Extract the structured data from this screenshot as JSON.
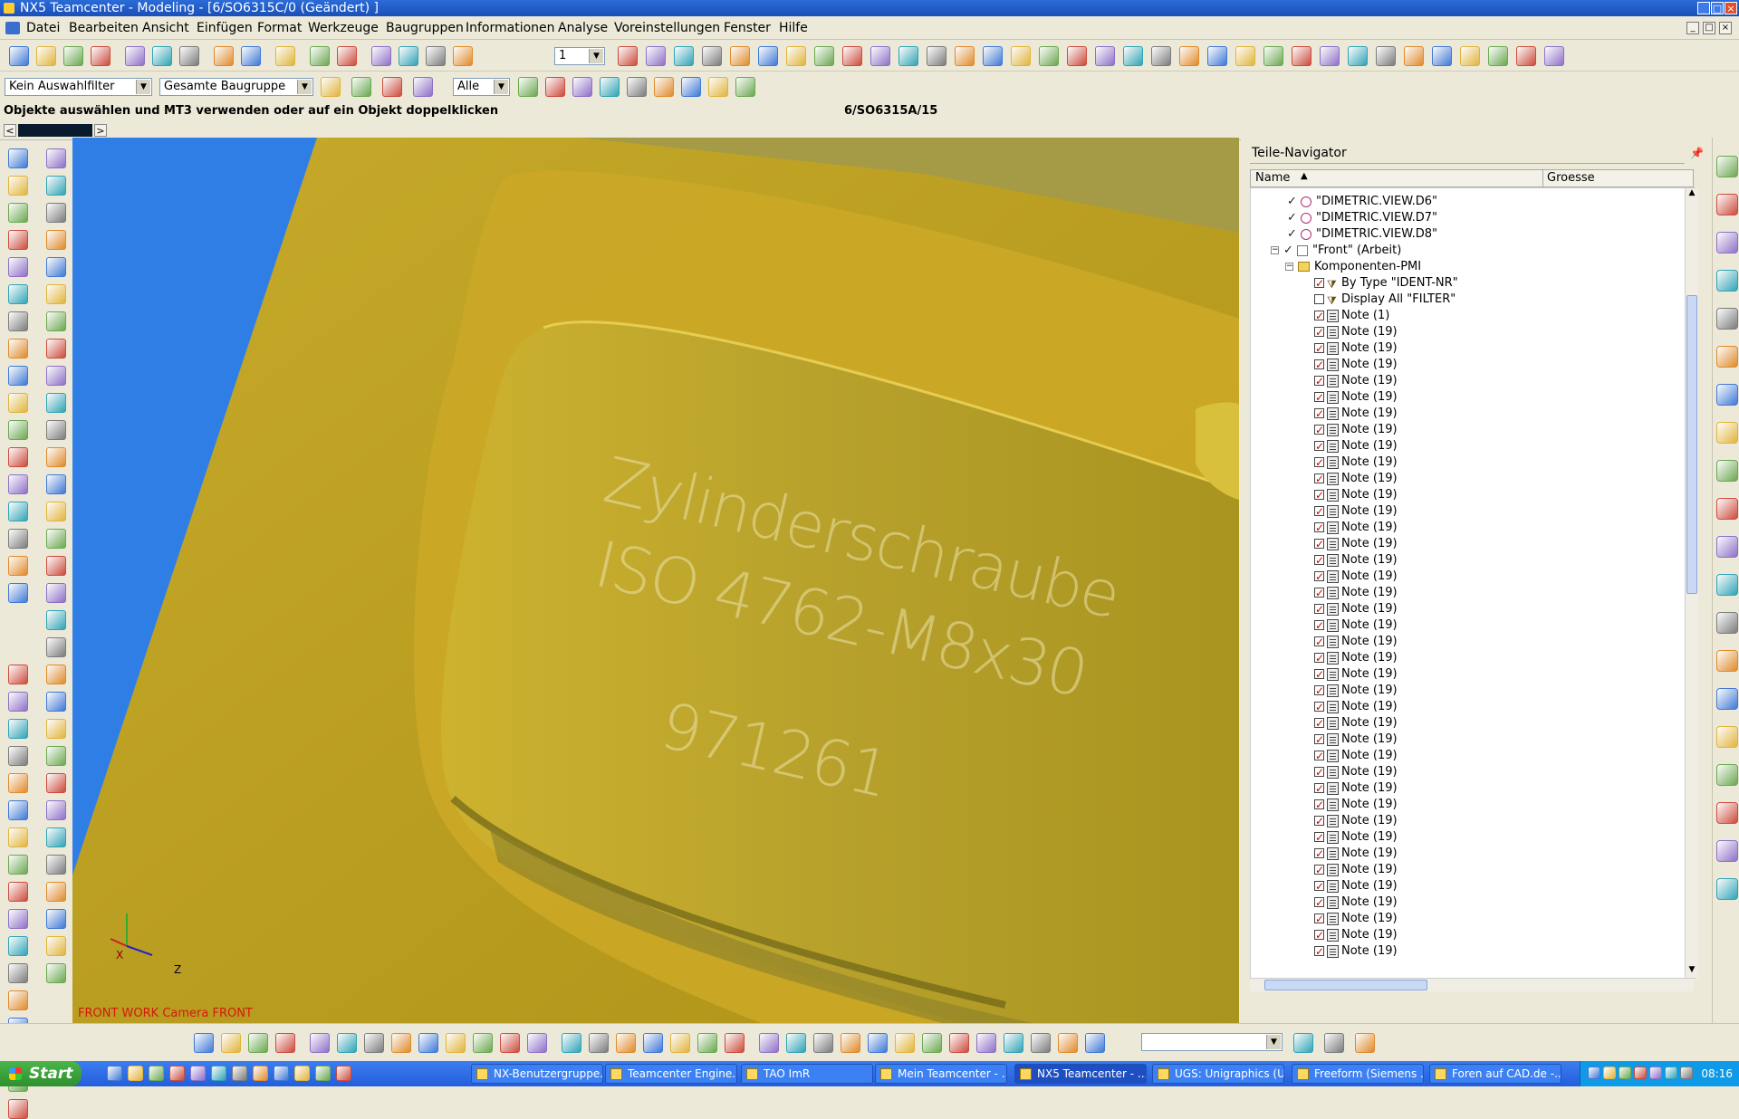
{
  "window": {
    "title": "NX5 Teamcenter - Modeling - [6/SO6315C/0 (Geändert) ]",
    "controls": [
      "_",
      "□",
      "×"
    ]
  },
  "menu": [
    "Datei",
    "Bearbeiten",
    "Ansicht",
    "Einfügen",
    "Format",
    "Werkzeuge",
    "Baugruppen",
    "Informationen",
    "Analyse",
    "Voreinstellungen",
    "Fenster",
    "Hilfe"
  ],
  "toolbar": {
    "layer_value": "1",
    "filter_value": "Kein Auswahlfilter",
    "assembly_value": "Gesamte Baugruppe",
    "scope_value": "Alle"
  },
  "status": {
    "prompt": "Objekte auswählen und MT3 verwenden oder auf ein Objekt doppelklicken",
    "part": "6/SO6315A/15"
  },
  "viewport": {
    "engraving": [
      "Zylinderschraube",
      "ISO 4762-M8x30",
      "971261"
    ],
    "view_label": "FRONT WORK Camera FRONT",
    "axes": {
      "x": "X",
      "z": "Z"
    }
  },
  "navigator": {
    "title": "Teile-Navigator",
    "columns": {
      "name": "Name",
      "size": "Groesse"
    },
    "nodes": [
      {
        "label": "\"DIMETRIC.VIEW.D6\"",
        "type": "view"
      },
      {
        "label": "\"DIMETRIC.VIEW.D7\"",
        "type": "view"
      },
      {
        "label": "\"DIMETRIC.VIEW.D8\"",
        "type": "view"
      },
      {
        "label": "\"Front\" (Arbeit)",
        "type": "front"
      },
      {
        "label": "Komponenten-PMI",
        "type": "folder"
      },
      {
        "label": "By Type \"IDENT-NR\"",
        "type": "filter"
      },
      {
        "label": "Display All \"FILTER\"",
        "type": "filter-off"
      },
      {
        "label": "Note (1)",
        "type": "note"
      }
    ],
    "note_label": "Note (19)",
    "note_count": 42
  },
  "taskbar": {
    "start": "Start",
    "tasks": [
      {
        "label": "NX-Benutzergruppe..."
      },
      {
        "label": "Teamcenter Engine..."
      },
      {
        "label": "TAO ImR"
      },
      {
        "label": "Mein Teamcenter - ..."
      },
      {
        "label": "NX5 Teamcenter - ..."
      },
      {
        "label": "UGS: Unigraphics (U..."
      },
      {
        "label": "Freeform (Siemens ..."
      },
      {
        "label": "Foren auf CAD.de -..."
      }
    ],
    "clock": "08:16"
  },
  "colors": {
    "titlebar": "#1a4fb8",
    "viewport_bg": "#2f7ee6",
    "part_yellow": "#c9a81f",
    "check_red": "#cc0000"
  }
}
